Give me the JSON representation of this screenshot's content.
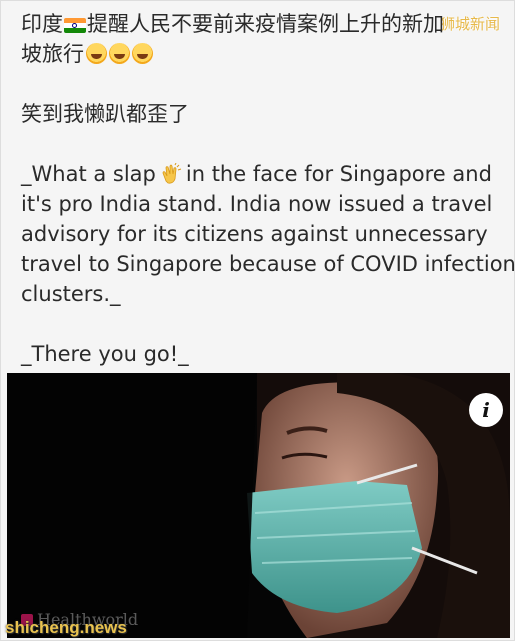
{
  "post": {
    "line1_prefix": "印度",
    "line1_suffix": "提醒人民不要前来疫情案例上升的新加",
    "line2": "坡旅行",
    "line3": "笑到我懒趴都歪了",
    "english_line1_a": "_What a slap",
    "english_line1_b": "in the face for Singapore and",
    "english_line2": "it's pro India stand. India now issued a travel",
    "english_line3": "advisory for its citizens against unnecessary",
    "english_line4": "travel to Singapore because of COVID infection",
    "english_line5": "clusters._",
    "english_line6": "_There you go!_"
  },
  "icons": {
    "flag": "india-flag-icon",
    "laugh": "rolling-laughing-emoji-icon",
    "clap": "clapping-hands-icon",
    "info": "info-icon"
  },
  "video": {
    "info_label": "i",
    "logo_text": "Healthworld",
    "logo_color": "#c2185b",
    "mask_color": "#5fb8b0"
  },
  "watermarks": {
    "top": "狮城新闻",
    "bottom": "shicheng.news",
    "color": "#e9c34f"
  }
}
